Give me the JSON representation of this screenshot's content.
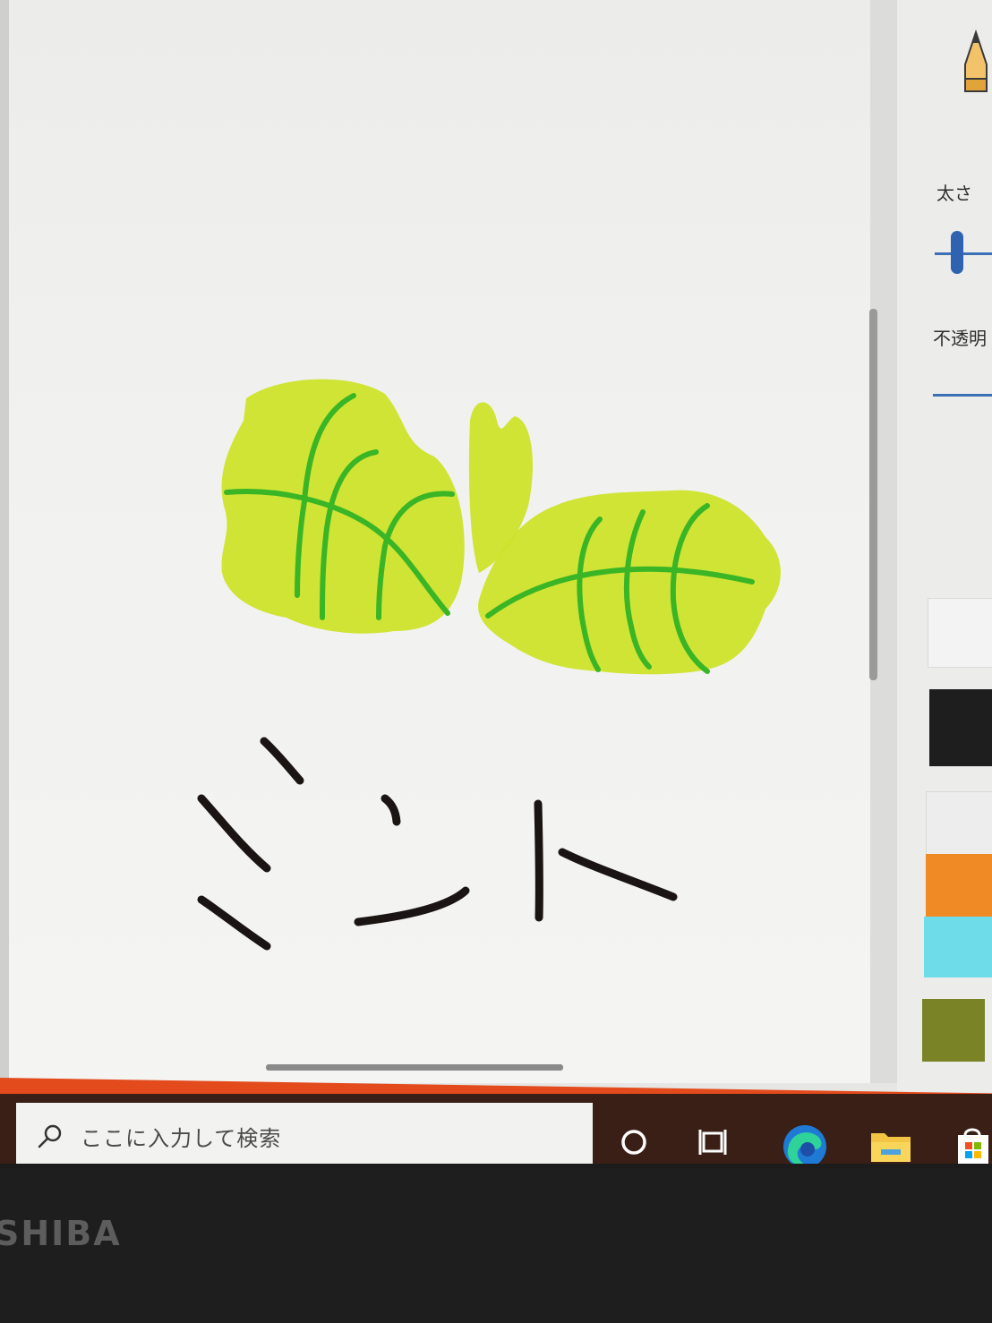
{
  "toolbar": {
    "thickness_label": "太さ",
    "opacity_label": "不透明",
    "tool_icon": "pencil-icon"
  },
  "colors": {
    "swatches": [
      "#f3f3f3",
      "#1e1e1e",
      "#ededed",
      "#f08a24",
      "#6fdcea",
      "#7a8427"
    ],
    "accent": "#2f62b0",
    "leaf_fill": "#cde32a",
    "leaf_vein": "#39b526",
    "ink": "#1a1412"
  },
  "taskbar": {
    "search_placeholder": "ここに入力して検索",
    "icons": [
      "cortana-icon",
      "task-view-icon",
      "edge-icon",
      "file-explorer-icon",
      "store-icon"
    ]
  },
  "bezel": {
    "brand": "SHIBA"
  }
}
